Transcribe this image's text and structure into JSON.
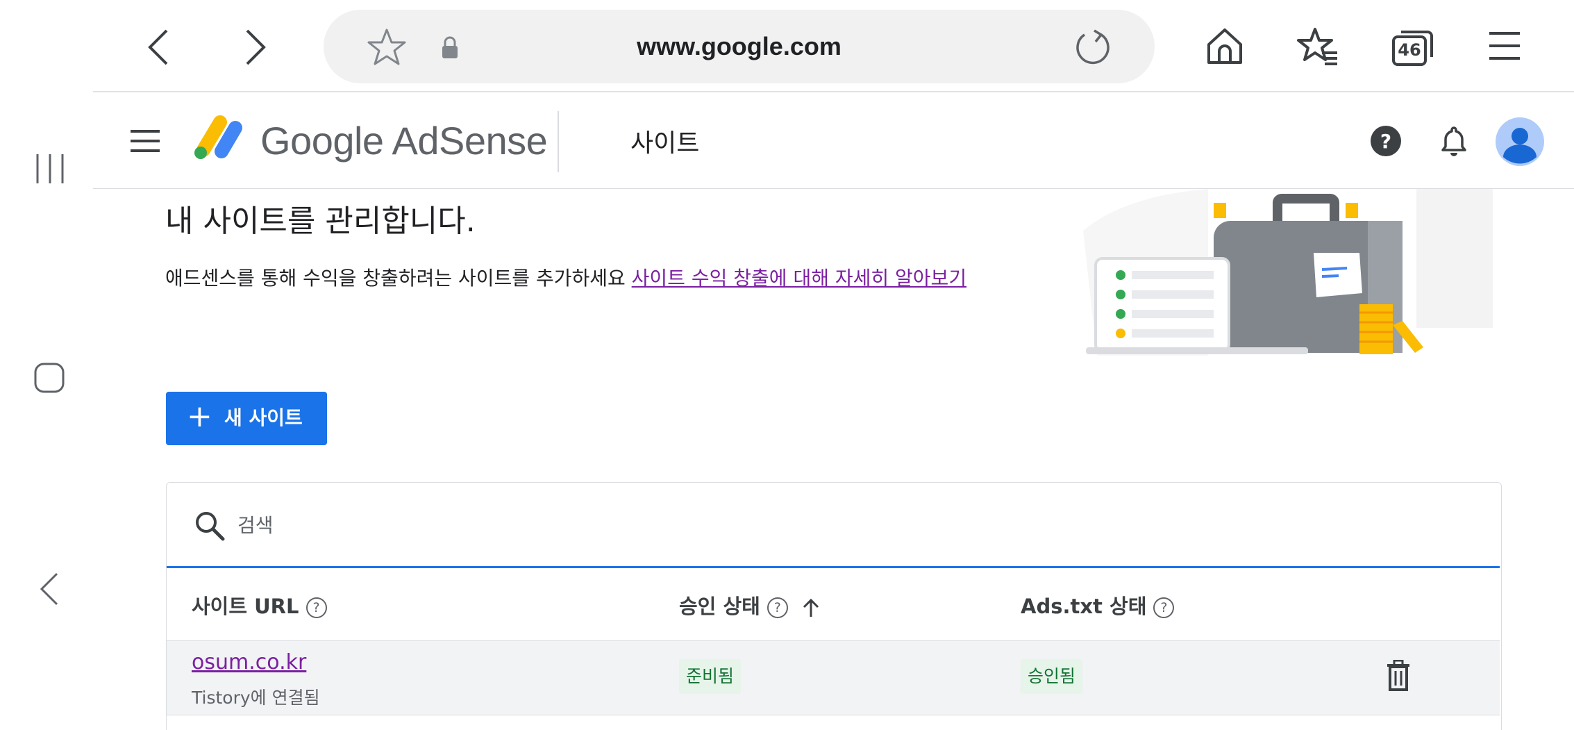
{
  "browser": {
    "url": "www.google.com",
    "tab_count": "46"
  },
  "header": {
    "brand_google": "Google",
    "brand_product": "AdSense",
    "page_title": "사이트"
  },
  "main": {
    "heading": "내 사이트를 관리합니다.",
    "description": "애드센스를 통해 수익을 창출하려는 사이트를 추가하세요",
    "learn_more_link": "사이트 수익 창출에 대해 자세히 알아보기",
    "new_site_button": "새 사이트",
    "new_site_icon": "+"
  },
  "table": {
    "search_placeholder": "검색",
    "columns": {
      "site_url": "사이트 URL",
      "approval_status": "승인 상태",
      "ads_txt_status": "Ads.txt 상태"
    },
    "rows": [
      {
        "site": "osum.co.kr",
        "sub": "Tistory에 연결됨",
        "approval": "준비됨",
        "ads_txt": "승인됨"
      }
    ]
  },
  "colors": {
    "primary": "#1a73e8",
    "link_visited": "#7b1fa2",
    "chip_bg": "#e6f4ea",
    "chip_text": "#137333"
  }
}
